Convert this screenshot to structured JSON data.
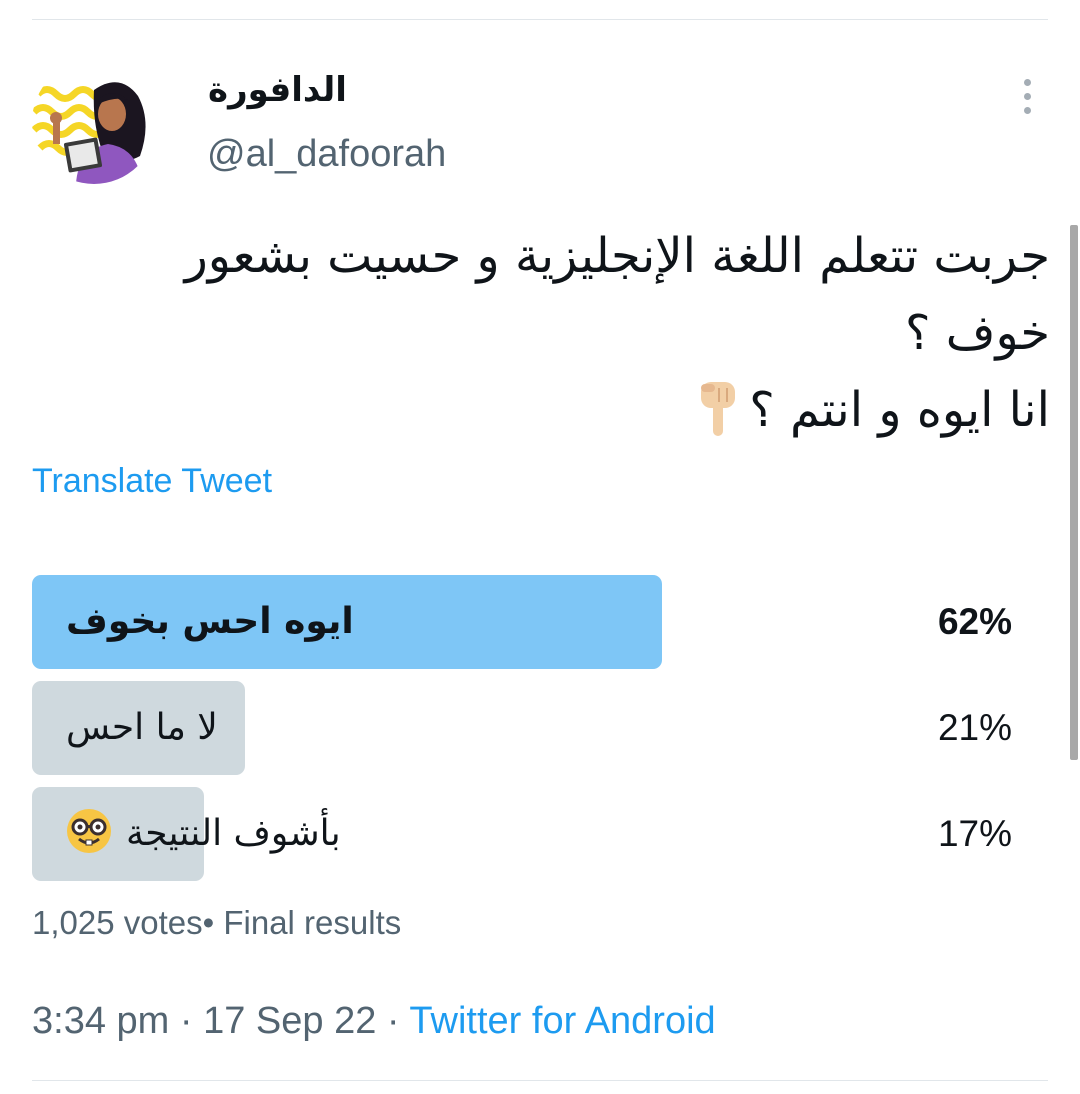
{
  "author": {
    "display_name": "الدافورة",
    "handle": "@al_dafoorah"
  },
  "tweet": {
    "lines": [
      "جربت تتعلم اللغة الإنجليزية و حسيت بشعور",
      "خوف ؟",
      "انا ايوه و انتم ؟"
    ],
    "emoji_icon": "backhand-index-pointing-down-icon"
  },
  "translate_label": "Translate Tweet",
  "poll": {
    "options": [
      {
        "label": "ايوه احس بخوف",
        "percent_label": "62%",
        "percent": 62,
        "winner": true
      },
      {
        "label": "لا ما احس",
        "percent_label": "21%",
        "percent": 21,
        "winner": false
      },
      {
        "label": "بأشوف النتيجة",
        "percent_label": "17%",
        "percent": 17,
        "winner": false,
        "icon": "nerd-face-icon"
      }
    ],
    "summary": "1,025 votes• Final results"
  },
  "meta": {
    "time": "3:34 pm · 17 Sep 22 · ",
    "source": "Twitter for Android"
  },
  "colors": {
    "winner_bar": "#7ec6f6",
    "other_bar": "#cfd9de",
    "link": "#1d9bf0",
    "secondary_text": "#536471"
  }
}
